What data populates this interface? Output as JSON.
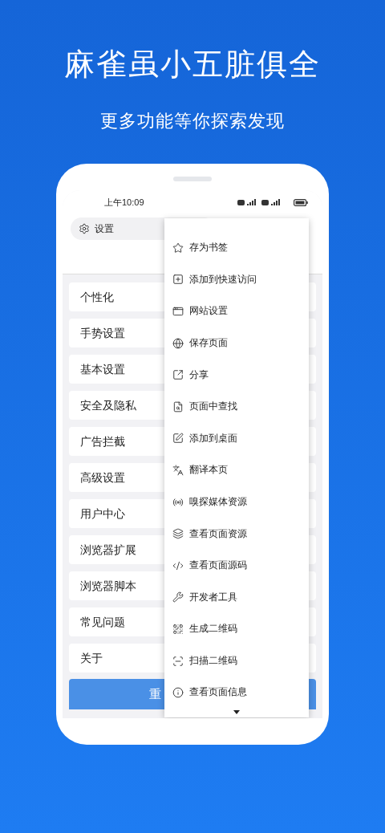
{
  "headline": "麻雀虽小五脏俱全",
  "subheadline": "更多功能等你探索发现",
  "status_bar": {
    "time": "上午10:09"
  },
  "header": {
    "title": "设置"
  },
  "settings_items": [
    {
      "label": "个性化"
    },
    {
      "label": "手势设置"
    },
    {
      "label": "基本设置"
    },
    {
      "label": "安全及隐私"
    },
    {
      "label": "广告拦截"
    },
    {
      "label": "高级设置"
    },
    {
      "label": "用户中心"
    },
    {
      "label": "浏览器扩展"
    },
    {
      "label": "浏览器脚本"
    },
    {
      "label": "常见问题"
    },
    {
      "label": "关于"
    }
  ],
  "button": {
    "label": "重"
  },
  "menu": {
    "items": [
      {
        "label": "存为书签"
      },
      {
        "label": "添加到快速访问"
      },
      {
        "label": "网站设置"
      },
      {
        "label": "保存页面"
      },
      {
        "label": "分享"
      },
      {
        "label": "页面中查找"
      },
      {
        "label": "添加到桌面"
      },
      {
        "label": "翻译本页"
      },
      {
        "label": "嗅探媒体资源"
      },
      {
        "label": "查看页面资源"
      },
      {
        "label": "查看页面源码"
      },
      {
        "label": "开发者工具"
      },
      {
        "label": "生成二维码"
      },
      {
        "label": "扫描二维码"
      },
      {
        "label": "查看页面信息"
      }
    ]
  }
}
